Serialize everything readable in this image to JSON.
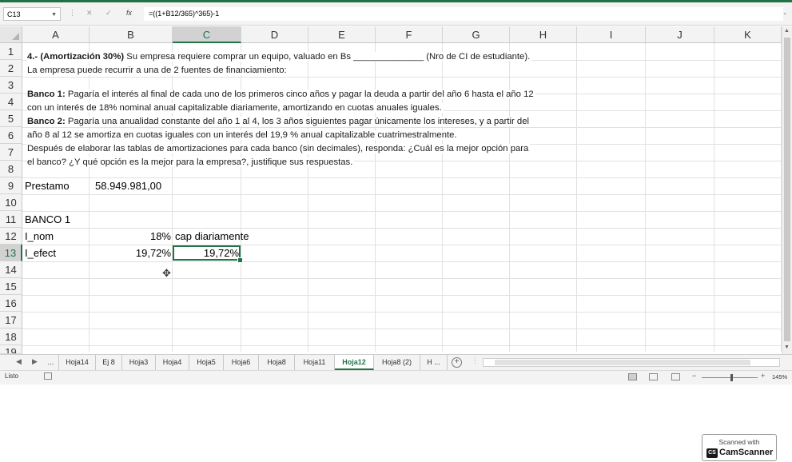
{
  "formula_bar": {
    "name_box": "C13",
    "fx": "fx",
    "formula": "=((1+B12/365)^365)-1"
  },
  "columns": [
    "A",
    "B",
    "C",
    "D",
    "E",
    "F",
    "G",
    "H",
    "I",
    "J",
    "K"
  ],
  "rows": [
    "1",
    "2",
    "3",
    "4",
    "5",
    "6",
    "7",
    "8",
    "9",
    "10",
    "11",
    "12",
    "13",
    "14",
    "15",
    "16",
    "17",
    "18",
    "19"
  ],
  "problem_text": {
    "line1_bold": "4.- (Amortización 30%)",
    "line1_rest": " Su empresa requiere comprar un equipo, valuado en Bs ______________ (Nro de CI de estudiante).",
    "line2": "La empresa puede recurrir a una de 2 fuentes de financiamiento:",
    "line3_bold": "Banco 1:",
    "line3_rest": " Pagaría el interés al final de cada uno de los primeros cinco años y pagar la deuda a partir del año 6 hasta el año 12",
    "line4": "con un interés de 18% nominal anual capitalizable diariamente, amortizando en cuotas anuales iguales.",
    "line5_bold": "Banco 2:",
    "line5_rest": " Pagaría una anualidad constante del año 1 al 4, los 3 años siguientes pagar únicamente los intereses, y a partir del",
    "line6": "año 8 al 12 se amortiza en cuotas iguales con un interés del 19,9 % anual capitalizable cuatrimestralmente.",
    "line7": "Después de elaborar las tablas de amortizaciones para cada banco (sin decimales), responda: ¿Cuál es la mejor opción para",
    "line8": "el banco? ¿Y qué opción es la mejor para la empresa?, justifique sus respuestas."
  },
  "cells": {
    "A9": "Prestamo",
    "B9": "58.949.981,00",
    "A11": "BANCO 1",
    "A12": "I_nom",
    "B12": "18%",
    "C12": "cap diariamente",
    "A13": "I_efect",
    "B13": "19,72%",
    "C13": "19,72%"
  },
  "sheet_tabs": {
    "ellipsis": "...",
    "tabs": [
      "Hoja14",
      "Ej 8",
      "Hoja3",
      "Hoja4",
      "Hoja5",
      "Hoja6",
      "Hoja8",
      "Hoja11",
      "Hoja12",
      "Hoja8 (2)",
      "H ..."
    ],
    "active": "Hoja12"
  },
  "status": {
    "ready": "Listo",
    "zoom": "145%"
  },
  "watermark": {
    "line1": "Scanned with",
    "logo": "CS",
    "brand": "CamScanner"
  },
  "colors": {
    "accent": "#217346"
  }
}
